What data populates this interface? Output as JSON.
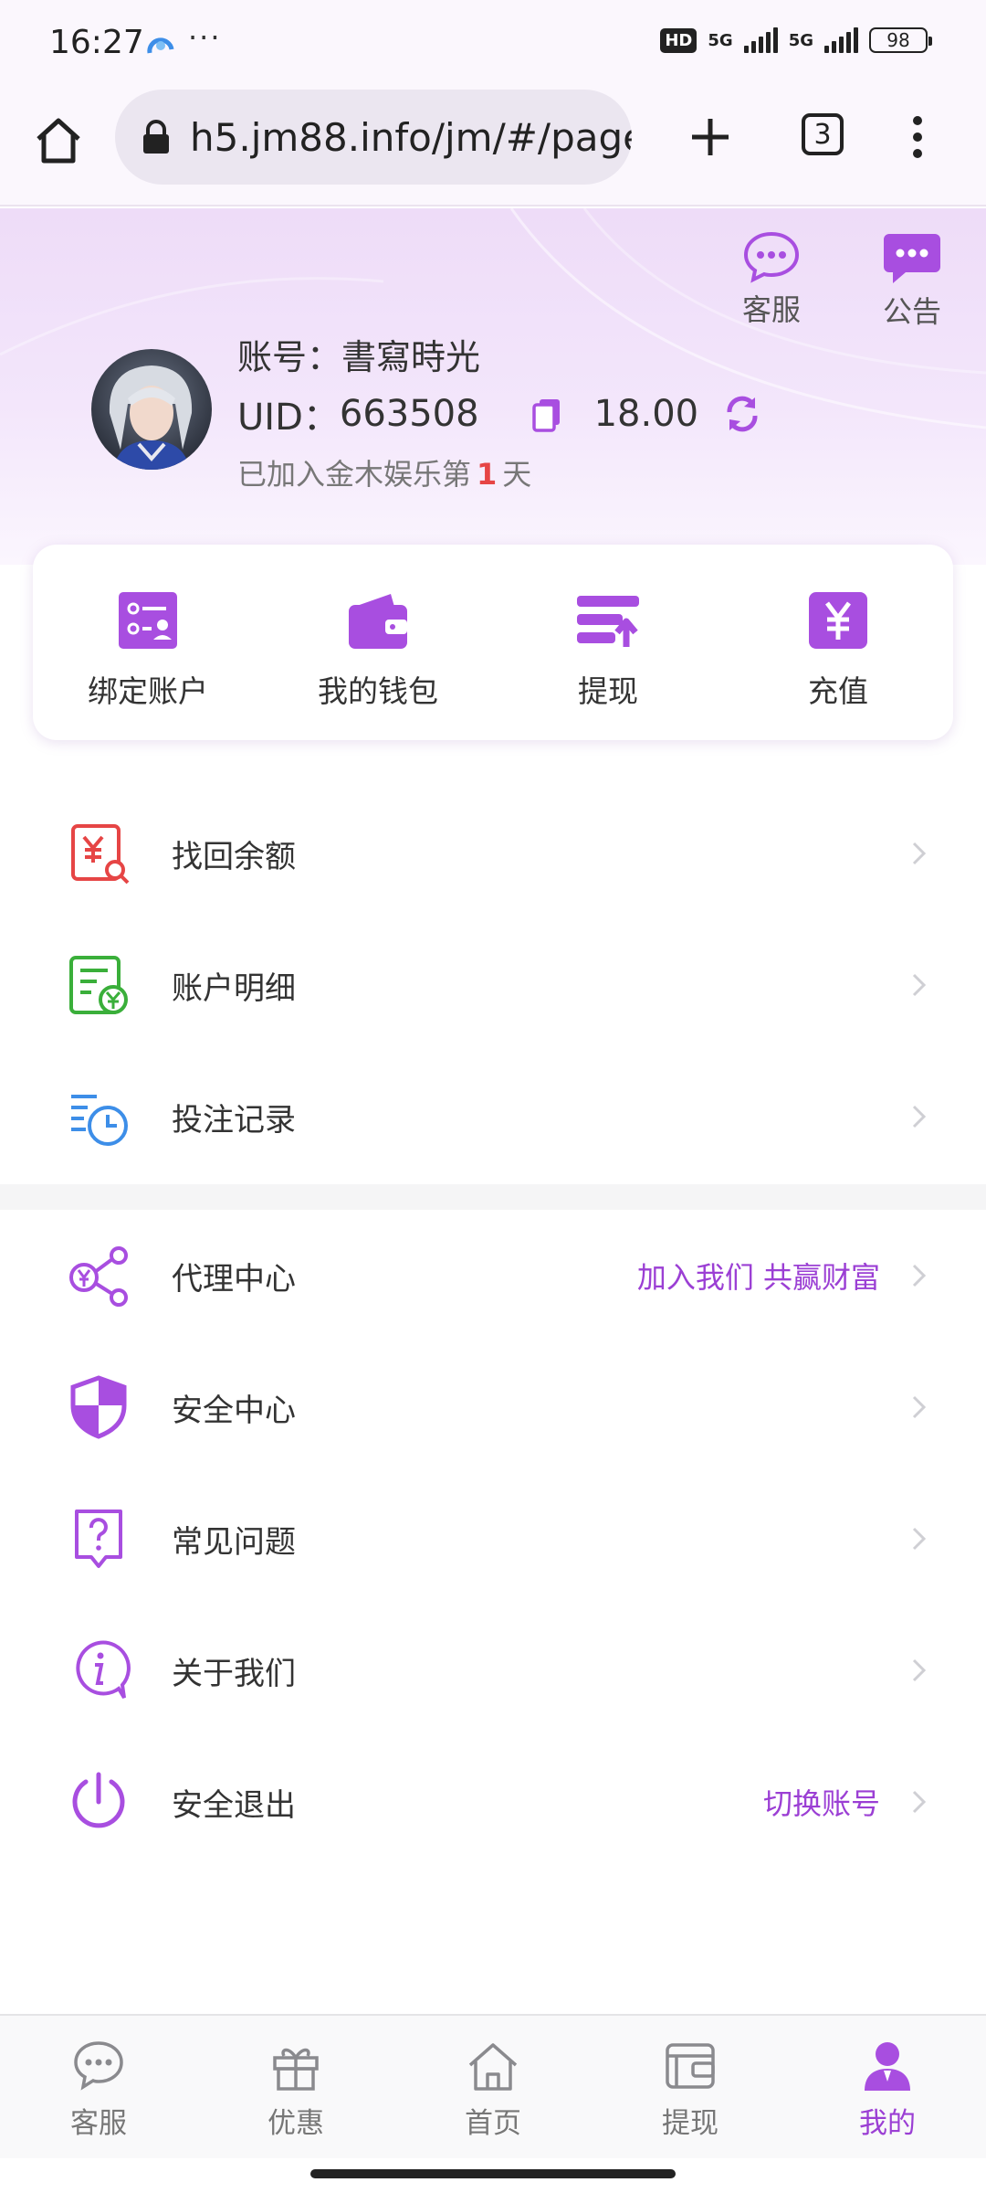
{
  "status_bar": {
    "time": "16:27",
    "dots": "···",
    "hd": "HD",
    "net1": "5G",
    "net2": "5G",
    "battery": "98"
  },
  "browser": {
    "url": "h5.jm88.info/jm/#/page",
    "tabs_count": "3"
  },
  "header": {
    "top_actions": [
      {
        "label": "客服",
        "icon": "chat-bubble-icon"
      },
      {
        "label": "公告",
        "icon": "announcement-icon"
      }
    ],
    "account_label": "账号：",
    "account_name": "書寫時光",
    "uid_label": "UID：",
    "uid": "663508",
    "balance": "18.00",
    "joined_prefix": "已加入金木娱乐第",
    "joined_days": "1",
    "joined_suffix": "天"
  },
  "quick_actions": [
    {
      "label": "绑定账户",
      "icon": "bind-account-icon"
    },
    {
      "label": "我的钱包",
      "icon": "wallet-icon"
    },
    {
      "label": "提现",
      "icon": "withdraw-icon"
    },
    {
      "label": "充值",
      "icon": "recharge-icon"
    }
  ],
  "menu_group_1": [
    {
      "label": "找回余额",
      "icon": "recover-balance-icon",
      "extra": ""
    },
    {
      "label": "账户明细",
      "icon": "account-detail-icon",
      "extra": ""
    },
    {
      "label": "投注记录",
      "icon": "bet-record-icon",
      "extra": ""
    }
  ],
  "menu_group_2": [
    {
      "label": "代理中心",
      "icon": "agent-center-icon",
      "extra": "加入我们 共赢财富"
    },
    {
      "label": "安全中心",
      "icon": "security-shield-icon",
      "extra": ""
    },
    {
      "label": "常见问题",
      "icon": "faq-icon",
      "extra": ""
    },
    {
      "label": "关于我们",
      "icon": "about-info-icon",
      "extra": ""
    },
    {
      "label": "安全退出",
      "icon": "power-icon",
      "extra": "切换账号"
    }
  ],
  "bottom_nav": [
    {
      "label": "客服",
      "icon": "chat-icon",
      "active": false
    },
    {
      "label": "优惠",
      "icon": "gift-icon",
      "active": false
    },
    {
      "label": "首页",
      "icon": "home-icon",
      "active": false
    },
    {
      "label": "提现",
      "icon": "withdraw-wallet-icon",
      "active": false
    },
    {
      "label": "我的",
      "icon": "profile-icon",
      "active": true
    }
  ],
  "colors": {
    "accent": "#9b3fd4",
    "accent_light": "#b45ff0",
    "red": "#e64545",
    "green": "#3aaf3a",
    "blue": "#3d8ee8"
  }
}
